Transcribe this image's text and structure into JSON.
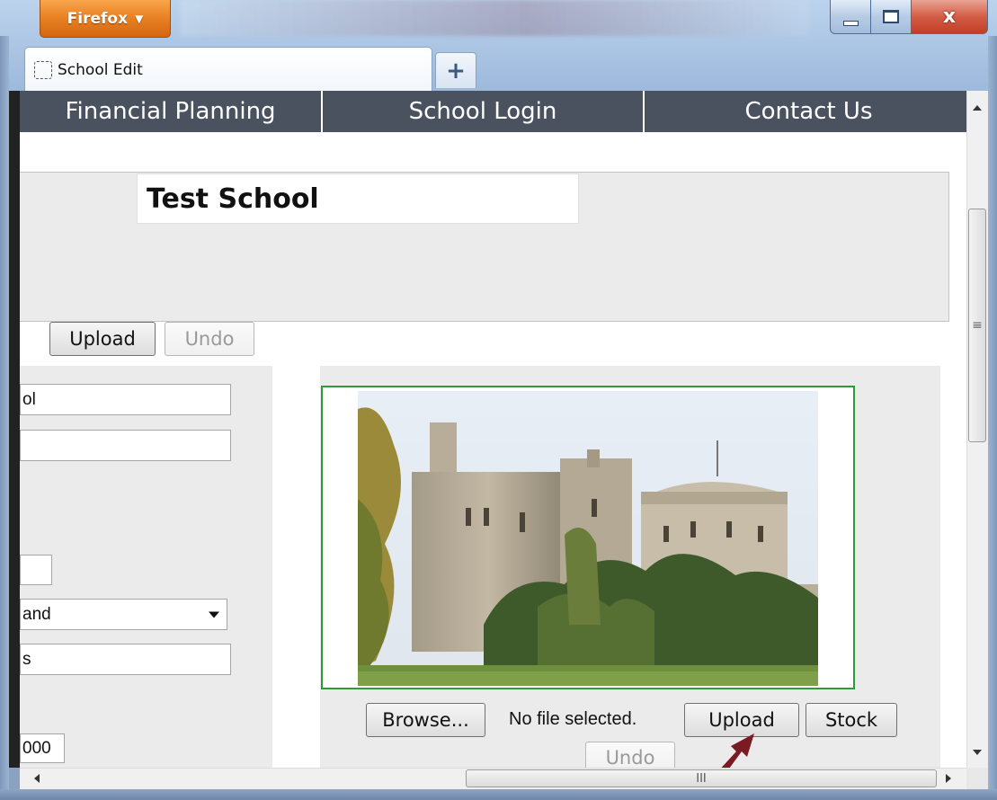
{
  "browser": {
    "menu_button_label": "Firefox",
    "tab_title": "School Edit",
    "new_tab_label": "+",
    "close_label": "x",
    "chrome_color": "#a9c3e2",
    "firefox_orange": "#e98325"
  },
  "nav": {
    "items": [
      "Financial Planning",
      "School Login",
      "Contact Us"
    ],
    "background": "#4a5260"
  },
  "school": {
    "name_value": "Test School"
  },
  "banner_controls": {
    "upload_label": "Upload",
    "undo_label": "Undo"
  },
  "form_fields": {
    "field1_value": "ol",
    "field2_value": "",
    "field3_value": "",
    "select_value": "and",
    "field4_value": "s",
    "field5_value": "000"
  },
  "photo_controls": {
    "browse_label": "Browse...",
    "status_text": "No file selected.",
    "upload_label": "Upload",
    "stock_label": "Stock",
    "undo_label": "Undo",
    "frame_color": "#2f9a3a"
  },
  "scrollbars": {
    "vertical_grip": "≡",
    "horizontal_grip": "III"
  }
}
